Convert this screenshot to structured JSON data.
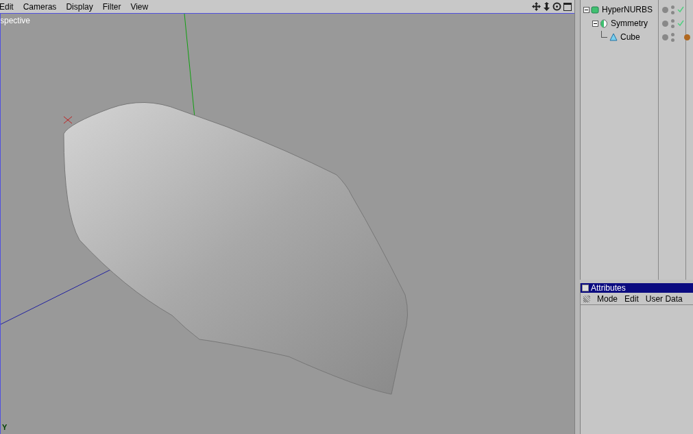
{
  "viewport": {
    "menu": [
      "Edit",
      "Cameras",
      "Display",
      "Filter",
      "View"
    ],
    "camera_label": "spective",
    "axis_label": "Y"
  },
  "objects": [
    {
      "name": "HyperNURBS",
      "kind": "nurbs",
      "enabled": true,
      "has_tag": false,
      "expanded": true,
      "children": [
        {
          "name": "Symmetry",
          "kind": "symmetry",
          "enabled": true,
          "has_tag": false,
          "expanded": true,
          "children": [
            {
              "name": "Cube",
              "kind": "polygon",
              "enabled": false,
              "has_tag": true
            }
          ]
        }
      ]
    }
  ],
  "attributes": {
    "title": "Attributes",
    "menu": [
      "Mode",
      "Edit",
      "User Data"
    ]
  }
}
